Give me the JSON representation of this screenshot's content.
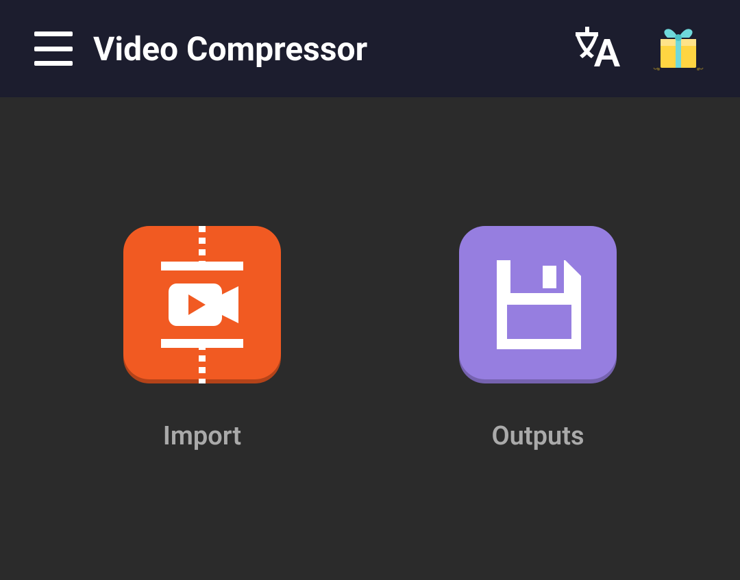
{
  "header": {
    "title": "Video Compressor"
  },
  "main": {
    "import_label": "Import",
    "outputs_label": "Outputs"
  },
  "colors": {
    "header_bg": "#1c1d2e",
    "body_bg": "#2b2b2b",
    "import_bg": "#f15a22",
    "outputs_bg": "#967ee0",
    "label_color": "#aaaaaa"
  }
}
